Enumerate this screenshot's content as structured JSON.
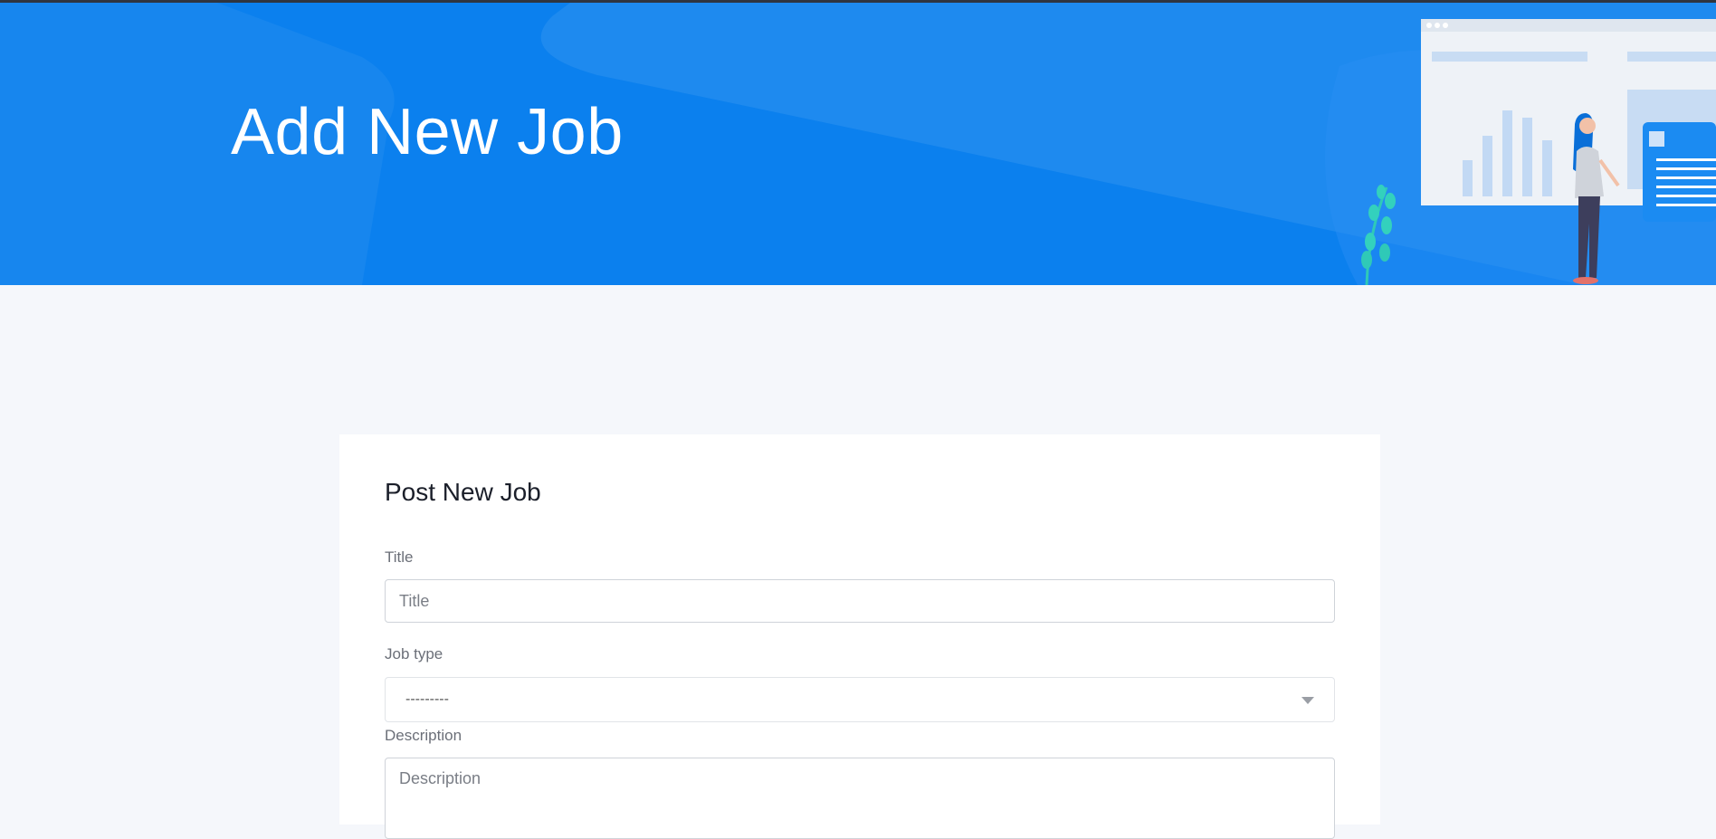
{
  "hero": {
    "title": "Add New Job",
    "background_color": "#0b80ee",
    "illustration": "analytics-dashboard-person-illustration"
  },
  "form": {
    "heading": "Post New Job",
    "fields": {
      "title": {
        "label": "Title",
        "placeholder": "Title",
        "value": ""
      },
      "job_type": {
        "label": "Job type",
        "selected": "---------"
      },
      "description": {
        "label": "Description",
        "placeholder": "Description",
        "value": ""
      }
    }
  },
  "icons": {
    "select_caret": "chevron-down-icon"
  }
}
